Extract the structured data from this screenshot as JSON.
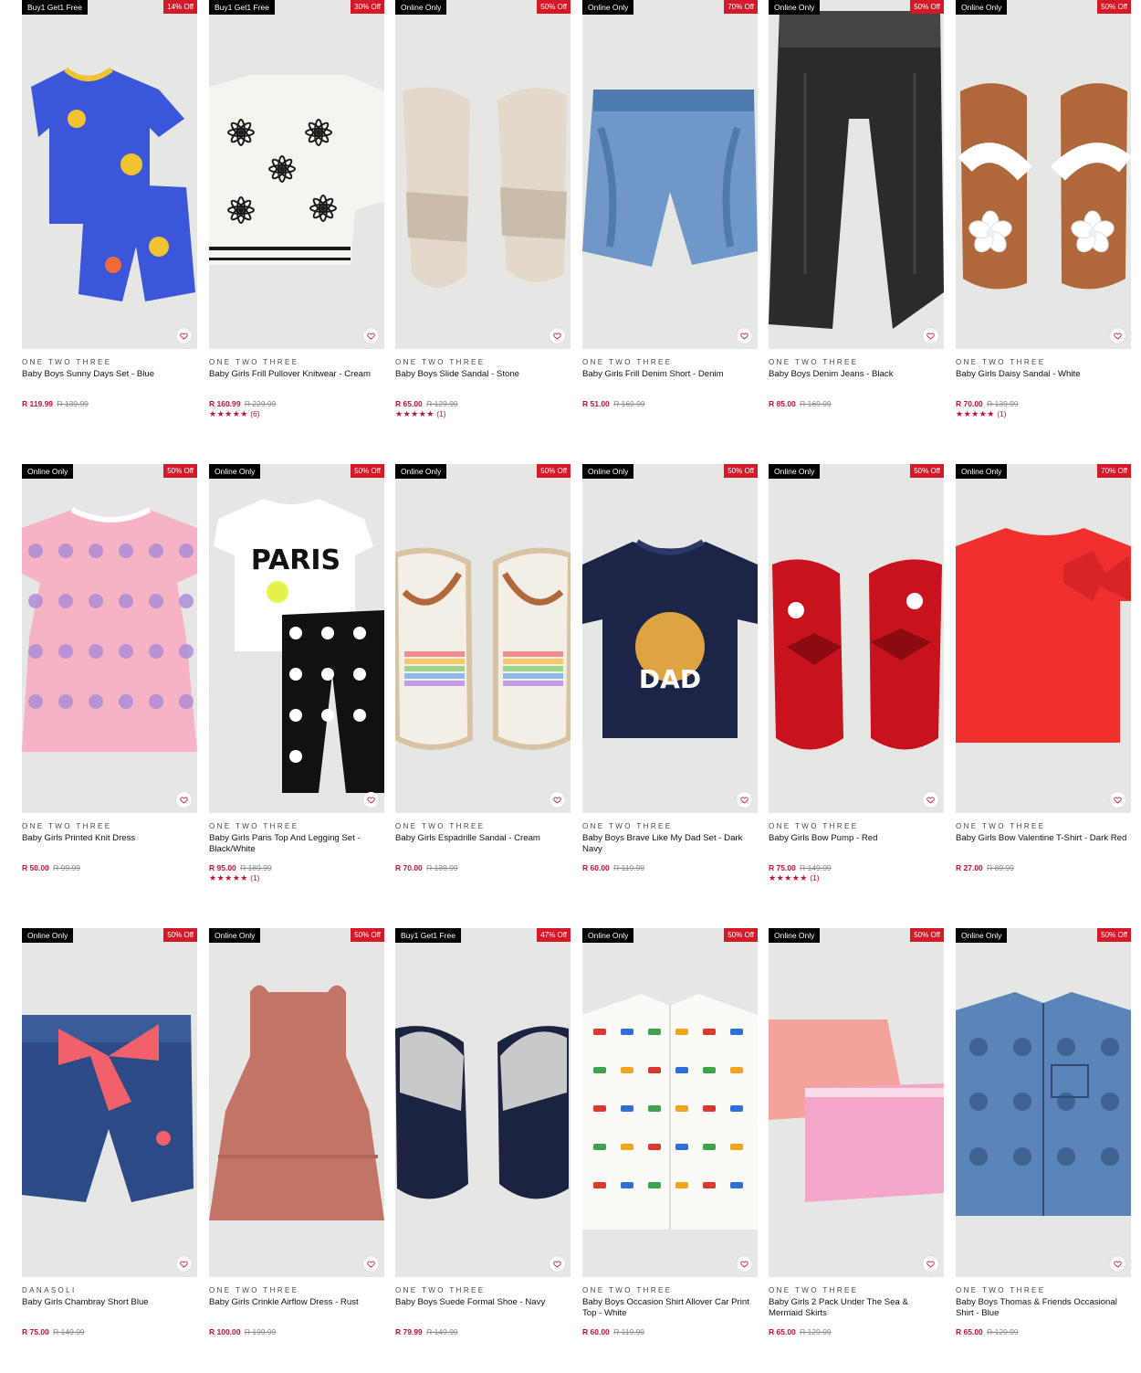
{
  "products": [
    {
      "tag": "Buy1 Get1 Free",
      "off": "14% Off",
      "brand": "ONE TWO THREE",
      "name": "Baby Boys Sunny Days Set - Blue",
      "price": "R 119.99",
      "was": "R 139.99",
      "stars": "",
      "reviews": "",
      "image": "blue-printed-tee-shorts-set",
      "colors": {
        "main": "#3b56d8",
        "accent": "#f2c330"
      }
    },
    {
      "tag": "Buy1 Get1 Free",
      "off": "30% Off",
      "brand": "ONE TWO THREE",
      "name": "Baby Girls Frill Pullover Knitwear - Cream",
      "price": "R 160.99",
      "was": "R 229.99",
      "stars": "★★★★★",
      "reviews": "(6)",
      "image": "cream-knit-sweater-black-flowers",
      "colors": {
        "main": "#f6f4ef",
        "accent": "#1a1a1a"
      }
    },
    {
      "tag": "Online Only",
      "off": "50% Off",
      "brand": "ONE TWO THREE",
      "name": "Baby Boys Slide Sandal - Stone",
      "price": "R 65.00",
      "was": "R 129.99",
      "stars": "★★★★★",
      "reviews": "(1)",
      "image": "stone-slide-sandals",
      "colors": {
        "main": "#e3d9cb",
        "accent": "#c9bda9"
      }
    },
    {
      "tag": "Online Only",
      "off": "70% Off",
      "brand": "ONE TWO THREE",
      "name": "Baby Girls Frill Denim Short - Denim",
      "price": "R 51.00",
      "was": "R 169.99",
      "stars": "",
      "reviews": "",
      "image": "denim-frill-shorts",
      "colors": {
        "main": "#6f98c8",
        "accent": "#4f7aad"
      }
    },
    {
      "tag": "Online Only",
      "off": "50% Off",
      "brand": "ONE TWO THREE",
      "name": "Baby Boys Denim Jeans - Black",
      "price": "R 85.00",
      "was": "R 169.99",
      "stars": "",
      "reviews": "",
      "image": "black-denim-jeans",
      "colors": {
        "main": "#2b2b2d",
        "accent": "#444447"
      }
    },
    {
      "tag": "Online Only",
      "off": "50% Off",
      "brand": "ONE TWO THREE",
      "name": "Baby Girls Daisy Sandal - White",
      "price": "R 70.00",
      "was": "R 139.99",
      "stars": "★★★★★",
      "reviews": "(1)",
      "image": "white-daisy-sandals",
      "colors": {
        "main": "#ffffff",
        "accent": "#b0673c"
      }
    },
    {
      "tag": "Online Only",
      "off": "50% Off",
      "brand": "ONE TWO THREE",
      "name": "Baby Girls Printed Knit Dress",
      "price": "R 50.00",
      "was": "R 99.99",
      "stars": "",
      "reviews": "",
      "image": "pink-floral-dress",
      "colors": {
        "main": "#f6b3c4",
        "accent": "#a98ad6"
      }
    },
    {
      "tag": "Online Only",
      "off": "50% Off",
      "brand": "ONE TWO THREE",
      "name": "Baby Girls Paris Top And Legging Set - Black/White",
      "price": "R 95.00",
      "was": "R 189.99",
      "stars": "★★★★★",
      "reviews": "(1)",
      "image": "paris-tee-daisy-leggings",
      "colors": {
        "main": "#ffffff",
        "accent": "#111111"
      }
    },
    {
      "tag": "Online Only",
      "off": "50% Off",
      "brand": "ONE TWO THREE",
      "name": "Baby Girls Espadrille Sandal - Cream",
      "price": "R 70.00",
      "was": "R 139.99",
      "stars": "",
      "reviews": "",
      "image": "rainbow-espadrille-sandals",
      "colors": {
        "main": "#f4efe6",
        "accent": "#b0673c"
      }
    },
    {
      "tag": "Online Only",
      "off": "50% Off",
      "brand": "ONE TWO THREE",
      "name": "Baby Boys Brave Like My Dad Set - Dark Navy",
      "price": "R 60.00",
      "was": "R 119.99",
      "stars": "",
      "reviews": "",
      "image": "navy-lion-king-tee",
      "colors": {
        "main": "#1c2548",
        "accent": "#e0a341"
      }
    },
    {
      "tag": "Online Only",
      "off": "50% Off",
      "brand": "ONE TWO THREE",
      "name": "Baby Girls Bow Pump - Red",
      "price": "R 75.00",
      "was": "R 149.99",
      "stars": "★★★★★",
      "reviews": "(1)",
      "image": "red-patent-bow-pumps",
      "colors": {
        "main": "#c8121d",
        "accent": "#8c0a12"
      }
    },
    {
      "tag": "Online Only",
      "off": "70% Off",
      "brand": "ONE TWO THREE",
      "name": "Baby Girls Bow Valentine T-Shirt - Dark Red",
      "price": "R 27.00",
      "was": "R 89.99",
      "stars": "",
      "reviews": "",
      "image": "red-bow-tshirt",
      "colors": {
        "main": "#f0302f",
        "accent": "#d82424"
      }
    },
    {
      "tag": "Online Only",
      "off": "50% Off",
      "brand": "DANASOLI",
      "name": "Baby Girls Chambray Short Blue",
      "price": "R 75.00",
      "was": "R 149.99",
      "stars": "",
      "reviews": "",
      "image": "chambray-shorts-pink-bow",
      "colors": {
        "main": "#2c4a85",
        "accent": "#f1616c"
      }
    },
    {
      "tag": "Online Only",
      "off": "50% Off",
      "brand": "ONE TWO THREE",
      "name": "Baby Girls Crinkle Airflow Dress - Rust",
      "price": "R 100.00",
      "was": "R 199.99",
      "stars": "",
      "reviews": "",
      "image": "rust-tiered-dress",
      "colors": {
        "main": "#c27566",
        "accent": "#b0665a"
      }
    },
    {
      "tag": "Buy1 Get1 Free",
      "off": "47% Off",
      "brand": "ONE TWO THREE",
      "name": "Baby Boys Suede Formal Shoe - Navy",
      "price": "R 79.99",
      "was": "R 149.99",
      "stars": "",
      "reviews": "",
      "image": "navy-suede-boat-shoes",
      "colors": {
        "main": "#1b2340",
        "accent": "#c9c9cc"
      }
    },
    {
      "tag": "Online Only",
      "off": "50% Off",
      "brand": "ONE TWO THREE",
      "name": "Baby Boys Occasion Shirt Allover Car Print Top - White",
      "price": "R 60.00",
      "was": "R 119.99",
      "stars": "",
      "reviews": "",
      "image": "white-car-print-shirt",
      "colors": {
        "main": "#fbfaf6",
        "accent": "#d83a2f"
      }
    },
    {
      "tag": "Online Only",
      "off": "50% Off",
      "brand": "ONE TWO THREE",
      "name": "Baby Girls 2 Pack Under The Sea & Mermaid Skirts",
      "price": "R 65.00",
      "was": "R 129.99",
      "stars": "",
      "reviews": "",
      "image": "two-pink-skirts",
      "colors": {
        "main": "#f3a39b",
        "accent": "#f3a6c8"
      }
    },
    {
      "tag": "Online Only",
      "off": "50% Off",
      "brand": "ONE TWO THREE",
      "name": "Baby Boys Thomas & Friends Occasional Shirt - Blue",
      "price": "R 65.00",
      "was": "R 129.99",
      "stars": "",
      "reviews": "",
      "image": "blue-thomas-shirt",
      "colors": {
        "main": "#5b84b8",
        "accent": "#2f4b76"
      }
    }
  ]
}
